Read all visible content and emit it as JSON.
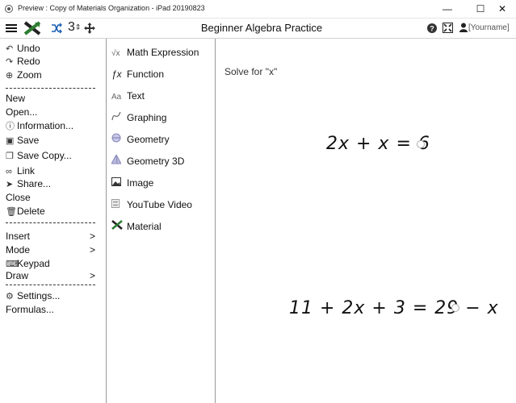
{
  "window": {
    "title": "Preview : Copy of Materials Organization - iPad 20190823",
    "minimize": "—",
    "maximize": "☐",
    "close": "✕"
  },
  "toolbar": {
    "title": "Beginner Algebra Practice",
    "username": "[Yourname]",
    "icons": [
      "hamburger-menu-icon",
      "app-logo-icon",
      "shuffle-icon",
      "numbering-icon",
      "move-icon",
      "help-icon",
      "fullscreen-icon",
      "user-icon"
    ]
  },
  "menu": {
    "undo": "Undo",
    "redo": "Redo",
    "zoom": "Zoom",
    "new": "New",
    "open": "Open...",
    "information": "Information...",
    "save": "Save",
    "save_copy": "Save Copy...",
    "link": "Link",
    "share": "Share...",
    "close": "Close",
    "delete": "Delete",
    "insert": "Insert",
    "mode": "Mode",
    "keypad": "Keypad",
    "draw": "Draw",
    "settings": "Settings...",
    "formulas": "Formulas...",
    "submenu_arrow": ">"
  },
  "insert_panel": {
    "items": [
      {
        "label": "Math Expression",
        "icon": "sqrt-icon"
      },
      {
        "label": "Function",
        "icon": "function-icon"
      },
      {
        "label": "Text",
        "icon": "text-icon"
      },
      {
        "label": "Graphing",
        "icon": "graph-icon"
      },
      {
        "label": "Geometry",
        "icon": "geometry-icon"
      },
      {
        "label": "Geometry 3D",
        "icon": "pyramid-icon"
      },
      {
        "label": "Image",
        "icon": "image-icon"
      },
      {
        "label": "YouTube Video",
        "icon": "video-icon"
      },
      {
        "label": "Material",
        "icon": "material-icon"
      }
    ],
    "icon_glyphs": {
      "sqrt": "√x",
      "function": "ƒx",
      "text": "Aa"
    }
  },
  "canvas": {
    "prompt": "Solve for \"x\"",
    "equations": [
      "2x + x = 6",
      "11 + 2x + 3 = 29 − x"
    ]
  },
  "colors": {
    "logo_green": "#2e7d32",
    "logo_dark": "#222222",
    "divider": "#999999",
    "accent_blue": "#1a5fb4"
  }
}
